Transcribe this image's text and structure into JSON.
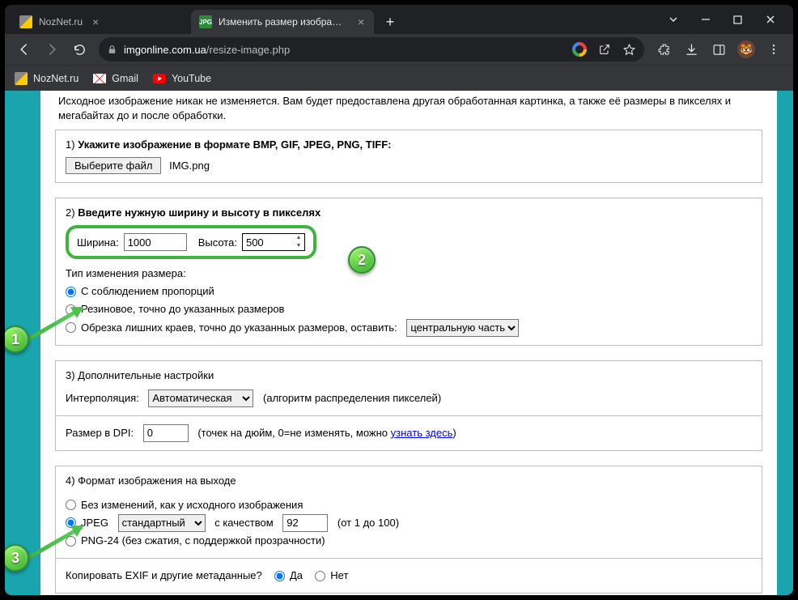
{
  "tabs": [
    {
      "title": "NozNet.ru",
      "active": false
    },
    {
      "title": "Изменить размер изображения",
      "active": true
    }
  ],
  "url": {
    "host": "imgonline.com.ua",
    "path": "/resize-image.php"
  },
  "bookmarks": [
    {
      "label": "NozNet.ru"
    },
    {
      "label": "Gmail"
    },
    {
      "label": "YouTube"
    }
  ],
  "intro": "Исходное изображение никак не изменяется. Вам будет предоставлена другая обработанная картинка, а также её размеры в пикселях и мегабайтах до и после обработки.",
  "s1": {
    "num": "1)",
    "title": "Укажите изображение в формате BMP, GIF, JPEG, PNG, TIFF:",
    "choose": "Выберите файл",
    "filename": "IMG.png"
  },
  "s2": {
    "num": "2)",
    "title": "Введите нужную ширину и высоту в пикселях",
    "width_label": "Ширина:",
    "width": "1000",
    "height_label": "Высота:",
    "height": "500",
    "type_label": "Тип изменения размера:",
    "opt1": "С соблюдением пропорций",
    "opt2": "Резиновое, точно до указанных размеров",
    "opt3": "Обрезка лишних краев, точно до указанных размеров, оставить:",
    "crop_select": "центральную часть"
  },
  "s3": {
    "title": "3) Дополнительные настройки",
    "interp_label": "Интерполяция:",
    "interp_value": "Автоматическая",
    "interp_note": "(алгоритм распределения пикселей)",
    "dpi_label": "Размер в DPI:",
    "dpi_value": "0",
    "dpi_note_a": "(точек на дюйм, 0=не изменять, можно ",
    "dpi_link": "узнать здесь",
    "dpi_note_b": ")"
  },
  "s4": {
    "title": "4) Формат изображения на выходе",
    "opt1": "Без изменений, как у исходного изображения",
    "jpeg": "JPEG",
    "jpeg_select": "стандартный",
    "quality_label": "с качеством",
    "quality": "92",
    "quality_note": "(от 1 до 100)",
    "png": "PNG-24 (без сжатия, с поддержкой прозрачности)",
    "exif": "Копировать EXIF и другие метаданные?",
    "yes": "Да",
    "no": "Нет"
  },
  "badges": {
    "b1": "1",
    "b2": "2",
    "b3": "3"
  }
}
